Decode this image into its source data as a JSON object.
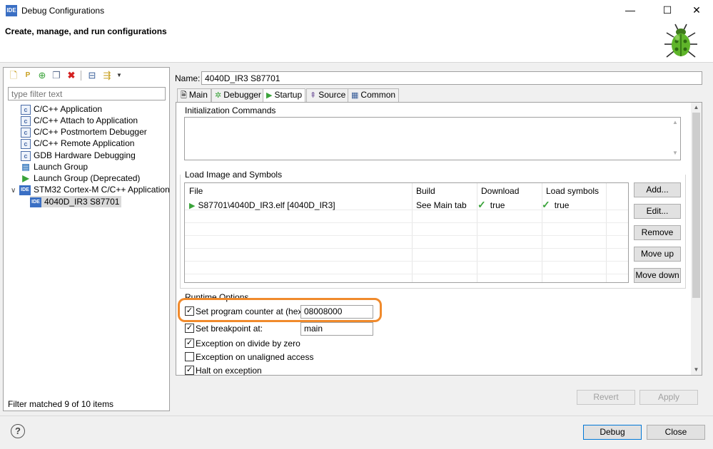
{
  "window": {
    "app_icon_text": "IDE",
    "title": "Debug Configurations",
    "minimize_glyph": "—",
    "maximize_glyph": "☐",
    "close_glyph": "✕"
  },
  "header": {
    "title": "Create, manage, and run configurations",
    "icon": "bug-icon"
  },
  "toolbar": {
    "icons": [
      "new-configuration-icon",
      "new-prototype-icon",
      "export-icon",
      "duplicate-icon",
      "delete-icon",
      "collapse-all-icon",
      "filter-icon",
      "dropdown-icon"
    ]
  },
  "filter": {
    "placeholder": "type filter text",
    "status": "Filter matched 9 of 10 items"
  },
  "tree": {
    "items": [
      {
        "label": "C/C++ Application",
        "icon": "c-app-icon"
      },
      {
        "label": "C/C++ Attach to Application",
        "icon": "c-app-icon"
      },
      {
        "label": "C/C++ Postmortem Debugger",
        "icon": "c-app-icon"
      },
      {
        "label": "C/C++ Remote Application",
        "icon": "c-app-icon"
      },
      {
        "label": "GDB Hardware Debugging",
        "icon": "c-app-icon"
      },
      {
        "label": "Launch Group",
        "icon": "launch-group-icon"
      },
      {
        "label": "Launch Group (Deprecated)",
        "icon": "launch-group-deprecated-icon"
      },
      {
        "label": "STM32 Cortex-M C/C++ Application",
        "icon": "ide-icon",
        "expanded": true
      },
      {
        "label": "4040D_IR3 S87701",
        "icon": "ide-icon",
        "selected": true
      }
    ],
    "c_icon_text": "c",
    "ide_icon_text": "IDE",
    "expand_glyph": "∨"
  },
  "config": {
    "name_label": "Name:",
    "name_value": "4040D_IR3 S87701",
    "tabs": [
      {
        "label": "Main",
        "icon": "main-tab-icon"
      },
      {
        "label": "Debugger",
        "icon": "debugger-tab-icon"
      },
      {
        "label": "Startup",
        "icon": "startup-tab-icon",
        "active": true
      },
      {
        "label": "Source",
        "icon": "source-tab-icon"
      },
      {
        "label": "Common",
        "icon": "common-tab-icon"
      }
    ],
    "init_commands_label": "Initialization Commands",
    "load_image_label": "Load Image and Symbols",
    "table": {
      "headers": [
        "File",
        "Build",
        "Download",
        "Load symbols"
      ],
      "rows": [
        {
          "file": "S87701\\4040D_IR3.elf [4040D_IR3]",
          "build": "See Main tab",
          "download": "true",
          "load_symbols": "true"
        }
      ]
    },
    "table_buttons": [
      "Add...",
      "Edit...",
      "Remove",
      "Move up",
      "Move down"
    ],
    "runtime_label": "Runtime Options",
    "options": [
      {
        "label": "Set program counter at (hex):",
        "checked": true,
        "value": "08008000"
      },
      {
        "label": "Set breakpoint at:",
        "checked": true,
        "value": "main"
      },
      {
        "label": "Exception on divide by zero",
        "checked": true
      },
      {
        "label": "Exception on unaligned access",
        "checked": false
      },
      {
        "label": "Halt on exception",
        "checked": true
      }
    ],
    "check_glyph": "✓",
    "revert_label": "Revert",
    "apply_label": "Apply"
  },
  "footer": {
    "help_glyph": "?",
    "debug_label": "Debug",
    "close_label": "Close"
  },
  "colors": {
    "highlight": "#f08a2c",
    "accent": "#0078d7"
  }
}
